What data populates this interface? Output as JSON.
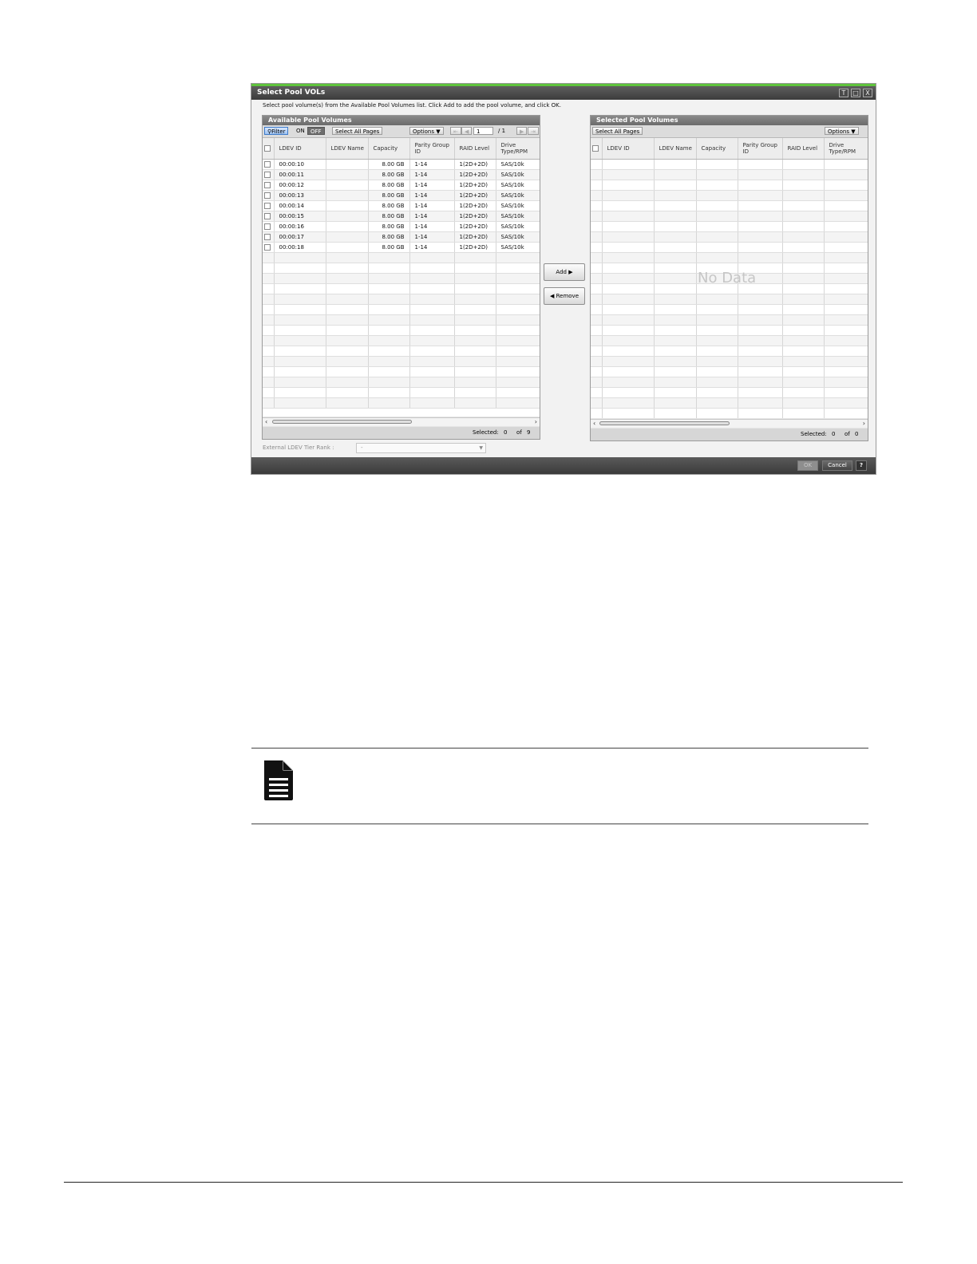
{
  "dialog": {
    "title": "Select Pool VOLs",
    "instructions": "Select pool volume(s) from the Available Pool Volumes list. Click Add to add the pool volume, and click OK.",
    "title_buttons": {
      "pin": "T",
      "maximize": "□",
      "close": "X"
    }
  },
  "available": {
    "title": "Available Pool Volumes",
    "toolbar": {
      "filter": "Filter",
      "on": "ON",
      "off": "OFF",
      "select_all": "Select All Pages",
      "options": "Options",
      "page": "1",
      "page_total": "/ 1"
    },
    "columns": [
      "LDEV ID",
      "LDEV Name",
      "Capacity",
      "Parity Group ID",
      "RAID Level",
      "Drive Type/RPM"
    ],
    "rows": [
      [
        "00:00:10",
        "",
        "8.00 GB",
        "1-14",
        "1(2D+2D)",
        "SAS/10k"
      ],
      [
        "00:00:11",
        "",
        "8.00 GB",
        "1-14",
        "1(2D+2D)",
        "SAS/10k"
      ],
      [
        "00:00:12",
        "",
        "8.00 GB",
        "1-14",
        "1(2D+2D)",
        "SAS/10k"
      ],
      [
        "00:00:13",
        "",
        "8.00 GB",
        "1-14",
        "1(2D+2D)",
        "SAS/10k"
      ],
      [
        "00:00:14",
        "",
        "8.00 GB",
        "1-14",
        "1(2D+2D)",
        "SAS/10k"
      ],
      [
        "00:00:15",
        "",
        "8.00 GB",
        "1-14",
        "1(2D+2D)",
        "SAS/10k"
      ],
      [
        "00:00:16",
        "",
        "8.00 GB",
        "1-14",
        "1(2D+2D)",
        "SAS/10k"
      ],
      [
        "00:00:17",
        "",
        "8.00 GB",
        "1-14",
        "1(2D+2D)",
        "SAS/10k"
      ],
      [
        "00:00:18",
        "",
        "8.00 GB",
        "1-14",
        "1(2D+2D)",
        "SAS/10k"
      ]
    ],
    "status": {
      "label": "Selected:",
      "selected": "0",
      "of": "of",
      "total": "9"
    }
  },
  "selected": {
    "title": "Selected Pool Volumes",
    "toolbar": {
      "select_all": "Select All Pages",
      "options": "Options"
    },
    "columns": [
      "LDEV ID",
      "LDEV Name",
      "Capacity",
      "Parity Group ID",
      "RAID Level",
      "Drive Type/RPM"
    ],
    "empty_text": "No Data",
    "status": {
      "label": "Selected:",
      "selected": "0",
      "of": "of",
      "total": "0"
    }
  },
  "actions": {
    "add": "Add",
    "remove": "Remove"
  },
  "tier_rank": {
    "label": "External LDEV Tier Rank :",
    "value": "-"
  },
  "footer": {
    "ok": "OK",
    "cancel": "Cancel",
    "help": "?"
  },
  "colors": {
    "title_accent": "#5fc43c",
    "titlebar": "#444444",
    "filter": "#9fc3f2"
  }
}
